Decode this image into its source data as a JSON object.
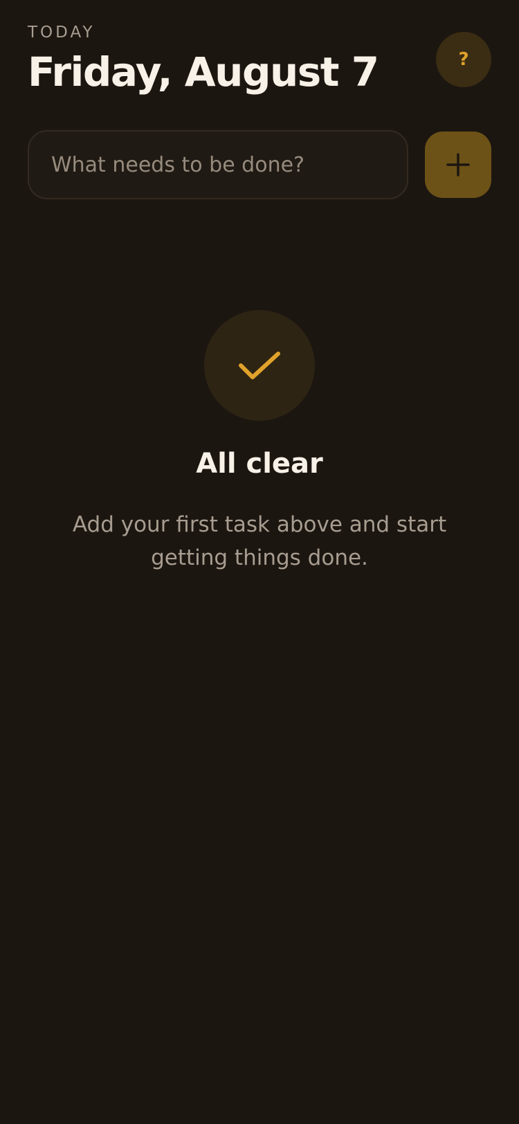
{
  "header": {
    "eyebrow": "TODAY",
    "title": "Friday, August 7",
    "help_label": "?"
  },
  "composer": {
    "placeholder": "What needs to be done?",
    "value": "",
    "add_icon": "plus-icon"
  },
  "empty_state": {
    "icon": "checkmark-icon",
    "title": "All clear",
    "subtitle": "Add your first task above and start getting things done."
  },
  "colors": {
    "background": "#1c1611",
    "accent": "#e0a22b",
    "accent_dim": "#6d5217",
    "text_primary": "#f7f1e8",
    "text_secondary": "#a79d90"
  }
}
